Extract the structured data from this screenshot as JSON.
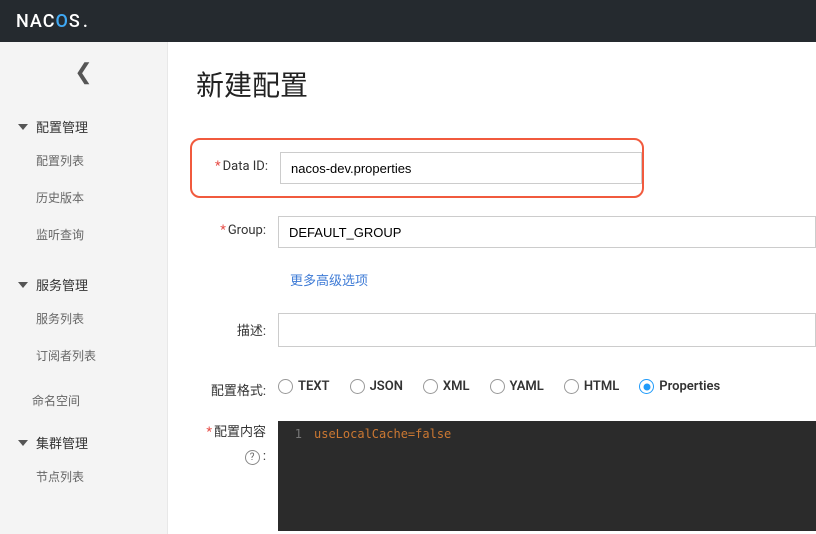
{
  "brand": {
    "pre": "NAC",
    "accent": "O",
    "post": "S",
    "dot": "."
  },
  "sidebar": {
    "groups": [
      {
        "label": "配置管理",
        "items": [
          {
            "label": "配置列表"
          },
          {
            "label": "历史版本"
          },
          {
            "label": "监听查询"
          }
        ]
      },
      {
        "label": "服务管理",
        "items": [
          {
            "label": "服务列表"
          },
          {
            "label": "订阅者列表"
          }
        ]
      }
    ],
    "flatItems": [
      {
        "label": "命名空间"
      }
    ],
    "groups2": [
      {
        "label": "集群管理",
        "items": [
          {
            "label": "节点列表"
          }
        ]
      }
    ]
  },
  "page": {
    "title": "新建配置",
    "form": {
      "dataId": {
        "label": "Data ID:",
        "value": "nacos-dev.properties"
      },
      "group": {
        "label": "Group:",
        "value": "DEFAULT_GROUP"
      },
      "advLink": "更多高级选项",
      "desc": {
        "label": "描述:",
        "value": ""
      },
      "format": {
        "label": "配置格式:",
        "options": [
          "TEXT",
          "JSON",
          "XML",
          "YAML",
          "HTML",
          "Properties"
        ],
        "selected": "Properties"
      },
      "content": {
        "label": "配置内容",
        "help": "?",
        "lineNo": "1",
        "code": "useLocalCache=false"
      }
    }
  }
}
